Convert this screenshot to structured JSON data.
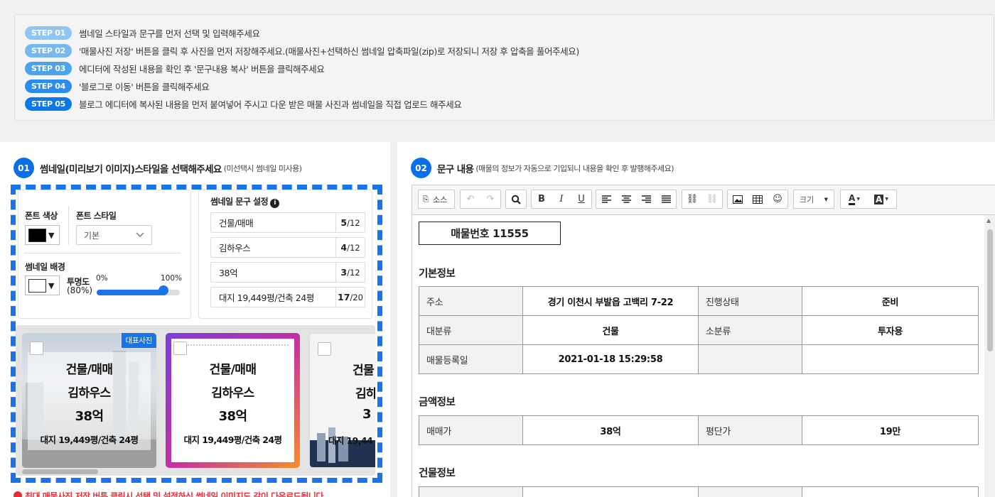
{
  "steps": [
    {
      "badge": "STEP 01",
      "color": "#8ec5f3",
      "text": "썸네일 스타일과 문구를 먼저 선택 및 입력해주세요"
    },
    {
      "badge": "STEP 02",
      "color": "#77b8f1",
      "text": "'매물사진 저장' 버튼을 클릭 후 사진을 먼저 저장해주세요.(매물사진+선택하신 썸네일 압축파일(zip)로 저장되니 저장 후 압축을 풀어주세요)"
    },
    {
      "badge": "STEP 03",
      "color": "#4ba3ee",
      "text": "에디터에 작성된 내용을 확인 후 '문구내용 복사' 버튼을 클릭해주세요"
    },
    {
      "badge": "STEP 04",
      "color": "#2a8ded",
      "text": "'블로그로 이동' 버튼을 클릭해주세요"
    },
    {
      "badge": "STEP 05",
      "color": "#0b78ea",
      "text": "블로그 에디터에 복사된 내용을 먼저 붙여넣어 주시고 다운 받은 매물 사진과 썸네일을 직접 업로드 해주세요"
    }
  ],
  "left": {
    "num": "01",
    "title": "썸네일(미리보기 이미지)스타일을 선택해주세요",
    "subtitle": "(미선택시 썸네일 미사용)",
    "font_color_label": "폰트 색상",
    "font_style_label": "폰트 스타일",
    "font_style_value": "기본",
    "bg_label": "썸네일 배경",
    "opacity_label": "투명도",
    "opacity_value": "(80%)",
    "opacity_min": "0%",
    "opacity_max": "100%",
    "opacity_fraction": 0.8,
    "text_settings_label": "썸네일 문구 설정",
    "text_rows": [
      {
        "value": "건물/매매",
        "count": "5",
        "max": "/12"
      },
      {
        "value": "김하우스",
        "count": "4",
        "max": "/12"
      },
      {
        "value": "38억",
        "count": "3",
        "max": "/12"
      },
      {
        "value": "대지 19,449평/건축 24평",
        "count": "17",
        "max": "/20"
      }
    ],
    "thumb_badge": "대표사진",
    "thumb_lines": [
      "건물/매매",
      "김하우스",
      "38억",
      "대지 19,449평/건축 24평"
    ],
    "thumb3_lines": [
      "건물",
      "김하",
      "3",
      "대지 19,44"
    ],
    "warning": "최대 매물사진 저장 버튼 클릭시 선택 및 설정하신 썸네일 이미지도 같이 다운로드됩니다"
  },
  "right": {
    "num": "02",
    "title": "문구 내용",
    "subtitle": "(매물의 정보가 자동으로 기입되니 내용을 확인 후 발행해주세요)",
    "toolbar": {
      "source": "소스",
      "size": "크기",
      "font_color": "A",
      "bg_color": "A"
    },
    "prop_number": "매물번호 11555",
    "basic_title": "기본정보",
    "basic_rows": [
      [
        "주소",
        "경기 이천시 부발읍 고백리 7-22",
        "진행상태",
        "준비"
      ],
      [
        "대분류",
        "건물",
        "소분류",
        "투자용"
      ],
      [
        "매물등록일",
        "2021-01-18 15:29:58",
        "",
        ""
      ]
    ],
    "price_title": "금액정보",
    "price_rows": [
      [
        "매매가",
        "38억",
        "평단가",
        "19만"
      ]
    ],
    "building_title": "건물정보"
  }
}
